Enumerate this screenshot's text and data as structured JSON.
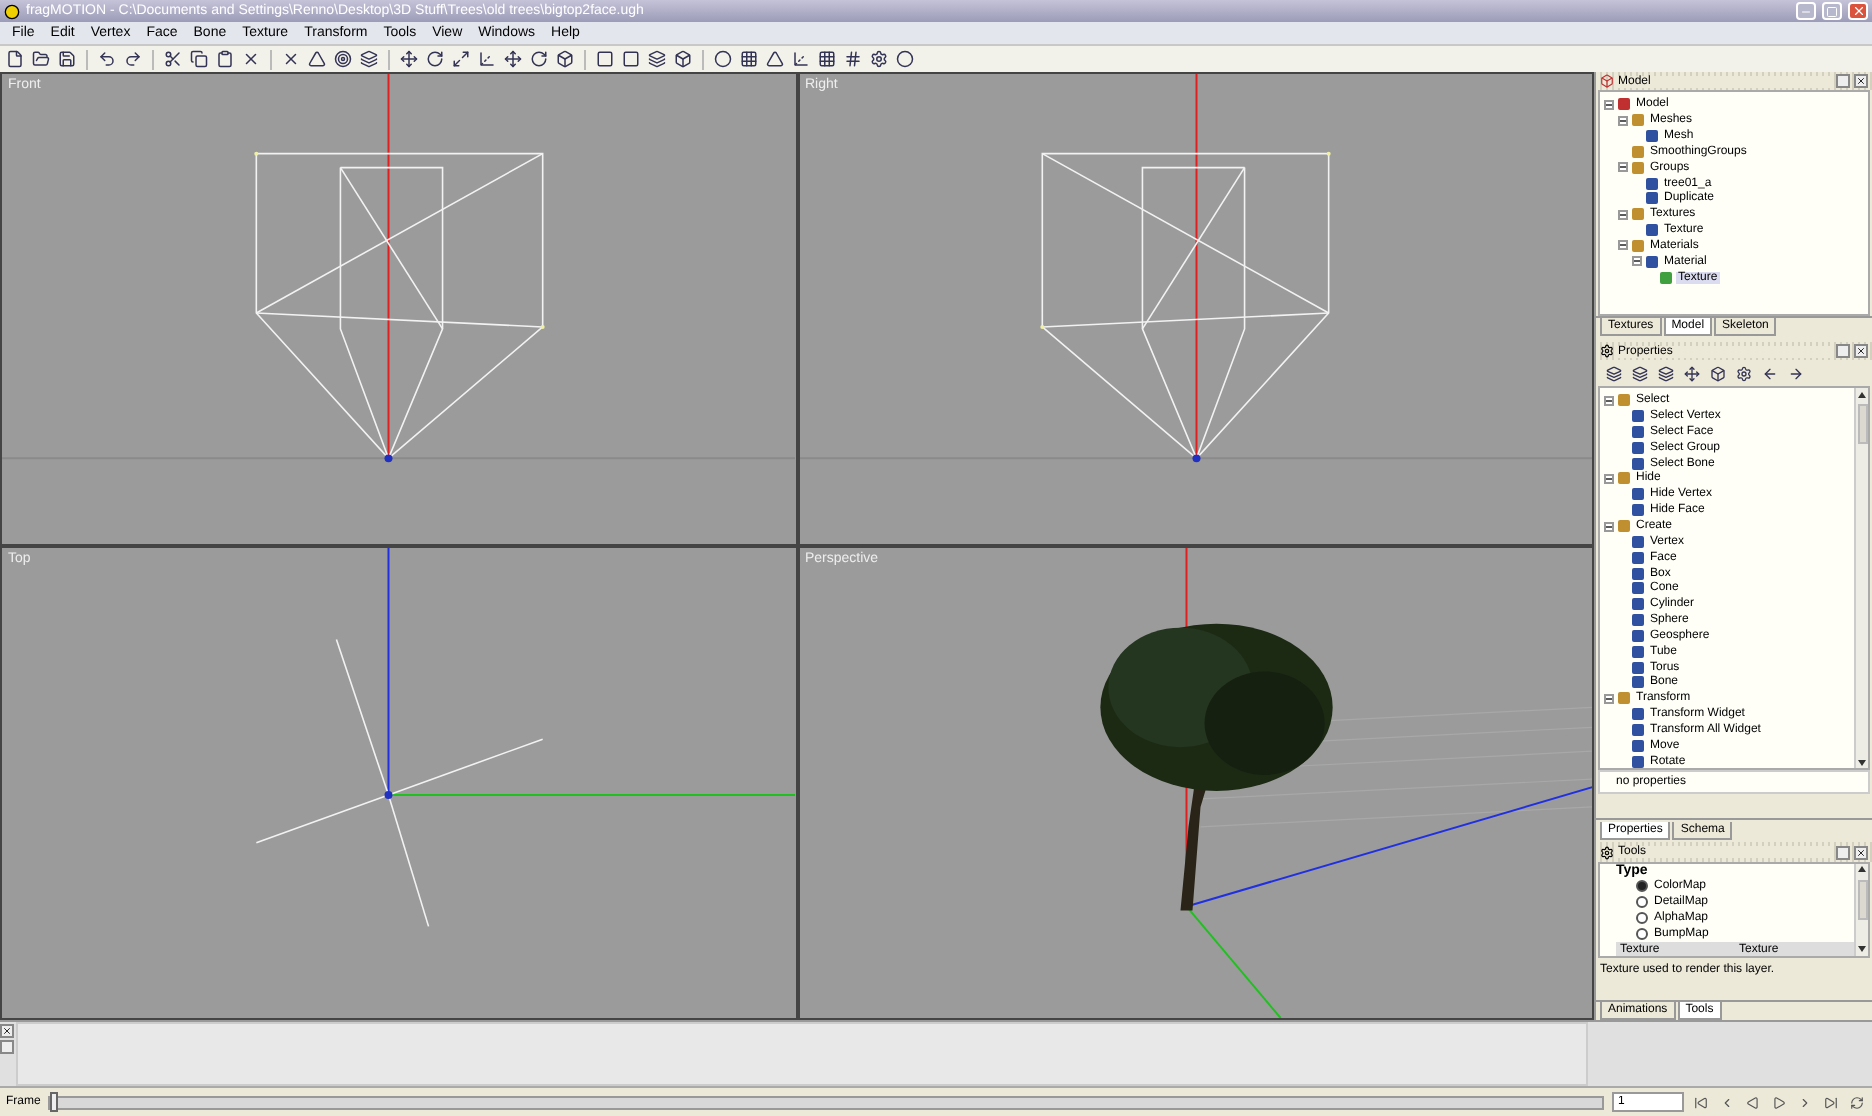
{
  "window": {
    "title": "fragMOTION - C:\\Documents and Settings\\Renno\\Desktop\\3D Stuff\\Trees\\old trees\\bigtop2face.ugh"
  },
  "menu": [
    "File",
    "Edit",
    "Vertex",
    "Face",
    "Bone",
    "Texture",
    "Transform",
    "Tools",
    "View",
    "Windows",
    "Help"
  ],
  "viewports": [
    {
      "label": "Front",
      "kind": "front"
    },
    {
      "label": "Right",
      "kind": "right"
    },
    {
      "label": "Top",
      "kind": "top"
    },
    {
      "label": "Perspective",
      "kind": "perspective"
    }
  ],
  "model_panel": {
    "title": "Model",
    "tree": [
      {
        "label": "Model",
        "expanded": true,
        "children": [
          {
            "label": "Meshes",
            "expanded": true,
            "children": [
              {
                "label": "Mesh"
              }
            ]
          },
          {
            "label": "SmoothingGroups"
          },
          {
            "label": "Groups",
            "expanded": true,
            "children": [
              {
                "label": "tree01_a"
              },
              {
                "label": "Duplicate"
              }
            ]
          },
          {
            "label": "Textures",
            "expanded": true,
            "children": [
              {
                "label": "Texture"
              }
            ]
          },
          {
            "label": "Materials",
            "expanded": true,
            "children": [
              {
                "label": "Material",
                "expanded": true,
                "children": [
                  {
                    "label": "Texture",
                    "selected": true
                  }
                ]
              }
            ]
          }
        ]
      }
    ],
    "tabs": [
      {
        "label": "Textures",
        "selected": false
      },
      {
        "label": "Model",
        "selected": true
      },
      {
        "label": "Skeleton",
        "selected": false
      }
    ]
  },
  "properties_panel": {
    "title": "Properties",
    "tree": [
      {
        "label": "Select",
        "expanded": true,
        "children": [
          {
            "label": "Select Vertex"
          },
          {
            "label": "Select Face"
          },
          {
            "label": "Select Group"
          },
          {
            "label": "Select Bone"
          }
        ]
      },
      {
        "label": "Hide",
        "expanded": true,
        "children": [
          {
            "label": "Hide Vertex"
          },
          {
            "label": "Hide Face"
          }
        ]
      },
      {
        "label": "Create",
        "expanded": true,
        "children": [
          {
            "label": "Vertex"
          },
          {
            "label": "Face"
          },
          {
            "label": "Box"
          },
          {
            "label": "Cone"
          },
          {
            "label": "Cylinder"
          },
          {
            "label": "Sphere"
          },
          {
            "label": "Geosphere"
          },
          {
            "label": "Tube"
          },
          {
            "label": "Torus"
          },
          {
            "label": "Bone"
          }
        ]
      },
      {
        "label": "Transform",
        "expanded": true,
        "children": [
          {
            "label": "Transform Widget"
          },
          {
            "label": "Transform All Widget"
          },
          {
            "label": "Move"
          },
          {
            "label": "Rotate"
          }
        ]
      }
    ],
    "status": "no properties",
    "tabs": [
      {
        "label": "Properties",
        "selected": true
      },
      {
        "label": "Schema",
        "selected": false
      }
    ]
  },
  "tools_panel": {
    "title": "Tools",
    "group": "Type",
    "options": [
      {
        "label": "ColorMap",
        "selected": true
      },
      {
        "label": "DetailMap",
        "selected": false
      },
      {
        "label": "AlphaMap",
        "selected": false
      },
      {
        "label": "BumpMap",
        "selected": false
      }
    ],
    "property": {
      "name": "Texture",
      "value": "Texture"
    },
    "description": "Texture used to render this layer.",
    "tabs": [
      {
        "label": "Animations",
        "selected": false
      },
      {
        "label": "Tools",
        "selected": true
      }
    ]
  },
  "frame_bar": {
    "label": "Frame",
    "level": 0,
    "value": "1"
  }
}
